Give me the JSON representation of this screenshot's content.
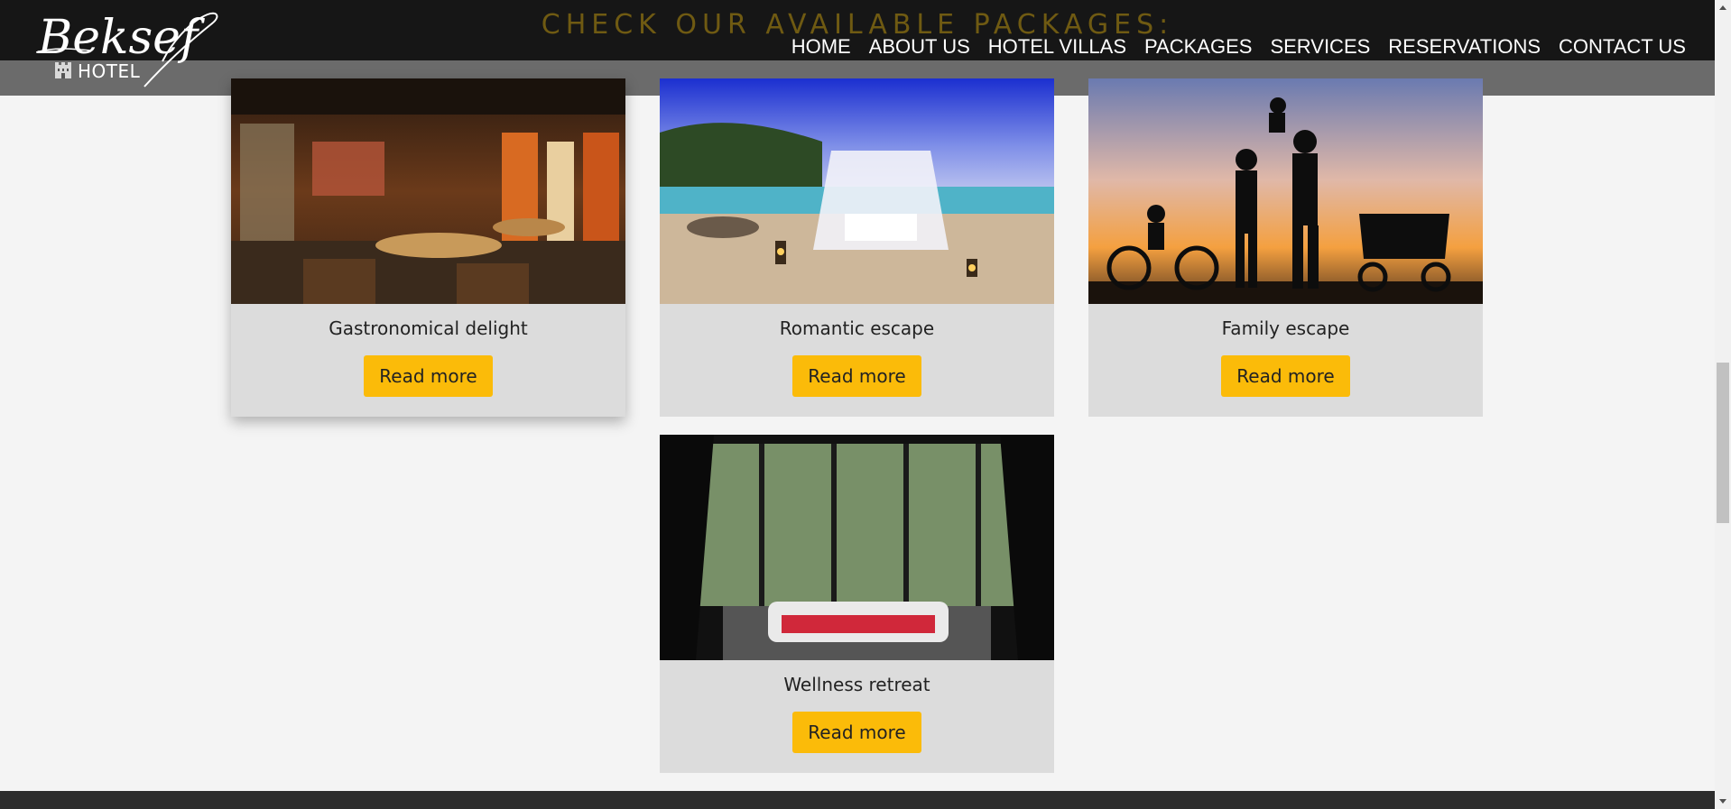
{
  "brand": {
    "script_name": "Beksef",
    "subtitle": "HOTEL"
  },
  "section_heading": "CHECK OUR AVAILABLE PACKAGES:",
  "nav": {
    "items": [
      {
        "label": "HOME"
      },
      {
        "label": "ABOUT US"
      },
      {
        "label": "HOTEL VILLAS"
      },
      {
        "label": "PACKAGES"
      },
      {
        "label": "SERVICES"
      },
      {
        "label": "RESERVATIONS"
      },
      {
        "label": "CONTACT US"
      }
    ]
  },
  "packages": [
    {
      "title": "Gastronomical delight",
      "button": "Read more",
      "image": "restaurant-interior"
    },
    {
      "title": "Romantic escape",
      "button": "Read more",
      "image": "beach-canopy-dinner"
    },
    {
      "title": "Family escape",
      "button": "Read more",
      "image": "family-silhouette-sunset"
    },
    {
      "title": "Wellness retreat",
      "button": "Read more",
      "image": "spa-bathtub-rose-petals"
    }
  ],
  "colors": {
    "accent": "#fbbb09",
    "topbar": "#161616",
    "subbar": "#6b6b6b",
    "card": "#dcdcdc",
    "footer": "#2d2d2d"
  }
}
